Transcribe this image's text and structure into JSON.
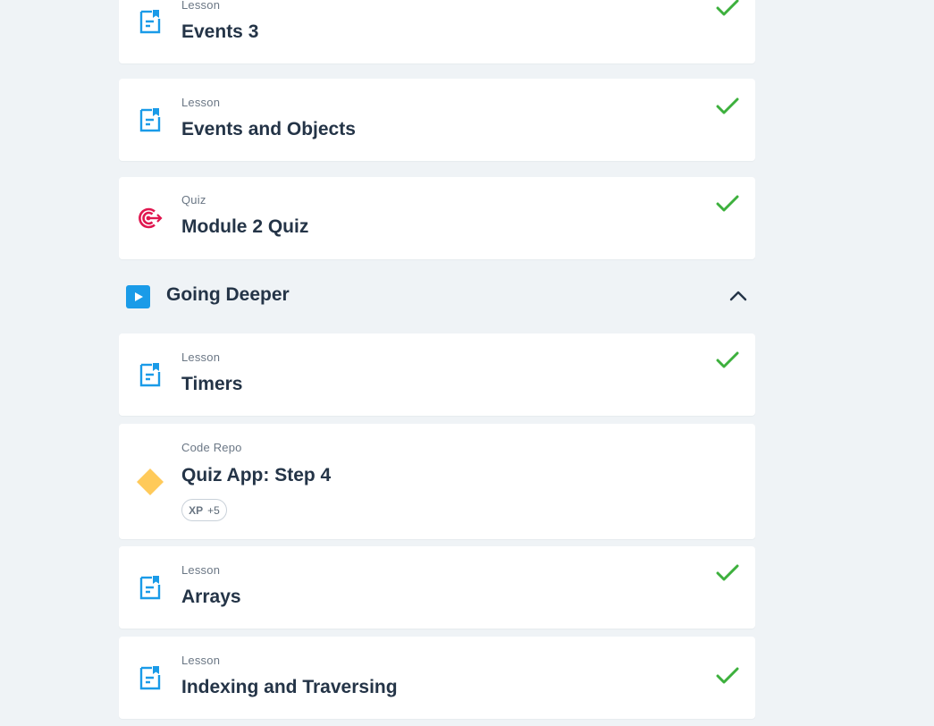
{
  "colors": {
    "background": "#eff3f6",
    "lesson_icon": "#1a9be8",
    "quiz_icon": "#e0164f",
    "repo_icon": "#ffca5a",
    "check": "#3db03d",
    "title_text": "#243447",
    "section_play": "#1a9be8"
  },
  "items_before": [
    {
      "type": "Lesson",
      "icon": "document-icon",
      "title": "Events 3",
      "completed": true
    },
    {
      "type": "Lesson",
      "icon": "document-icon",
      "title": "Events and Objects",
      "completed": true
    },
    {
      "type": "Quiz",
      "icon": "target-icon",
      "title": "Module 2 Quiz",
      "completed": true
    }
  ],
  "section": {
    "title": "Going Deeper",
    "icon": "play-icon",
    "toggle_icon": "chevron-up-icon",
    "expanded": true
  },
  "items_after": [
    {
      "type": "Lesson",
      "icon": "document-icon",
      "title": "Timers",
      "completed": true
    },
    {
      "type": "Code Repo",
      "icon": "diamond-icon",
      "title": "Quiz App: Step 4",
      "completed": false,
      "xp_label": "XP",
      "xp_value": "+5"
    },
    {
      "type": "Lesson",
      "icon": "document-icon",
      "title": "Arrays",
      "completed": true
    },
    {
      "type": "Lesson",
      "icon": "document-icon",
      "title": "Indexing and Traversing",
      "completed": true
    }
  ]
}
